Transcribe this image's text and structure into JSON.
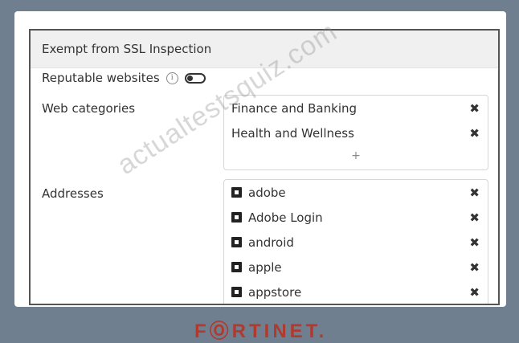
{
  "panel": {
    "title": "Exempt from SSL Inspection",
    "reputable_label": "Reputable websites",
    "reputable_enabled": false,
    "categories_label": "Web categories",
    "addresses_label": "Addresses",
    "categories": [
      "Finance and Banking",
      "Health and Wellness"
    ],
    "addresses": [
      "adobe",
      "Adobe Login",
      "android",
      "apple",
      "appstore"
    ],
    "remove_symbol": "✖",
    "add_symbol": "+",
    "info_symbol": "i"
  },
  "watermark": "actualtestsquiz.com",
  "logo": "FⓄRTINET."
}
